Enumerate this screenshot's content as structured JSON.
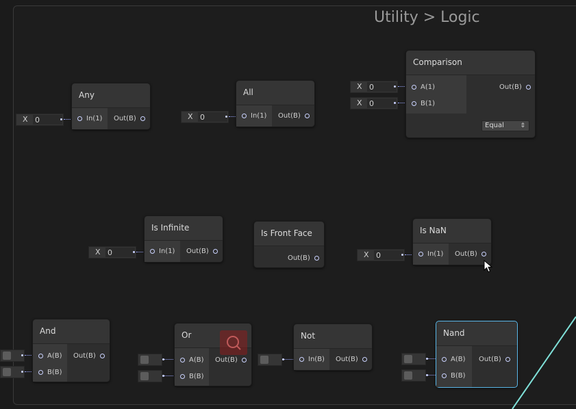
{
  "group_title": "Utility > Logic",
  "nodes": {
    "any": {
      "title": "Any",
      "in": "In(1)",
      "out": "Out(B)"
    },
    "all": {
      "title": "All",
      "in": "In(1)",
      "out": "Out(B)"
    },
    "comparison": {
      "title": "Comparison",
      "in_a": "A(1)",
      "in_b": "B(1)",
      "out": "Out(B)",
      "dropdown": "Equal"
    },
    "is_infinite": {
      "title": "Is Infinite",
      "in": "In(1)",
      "out": "Out(B)"
    },
    "is_front_face": {
      "title": "Is Front Face",
      "out": "Out(B)"
    },
    "is_nan": {
      "title": "Is NaN",
      "in": "In(1)",
      "out": "Out(B)"
    },
    "and": {
      "title": "And",
      "in_a": "A(B)",
      "in_b": "B(B)",
      "out": "Out(B)"
    },
    "or": {
      "title": "Or",
      "in_a": "A(B)",
      "in_b": "B(B)",
      "out": "Out(B)"
    },
    "not": {
      "title": "Not",
      "in": "In(B)",
      "out": "Out(B)"
    },
    "nand": {
      "title": "Nand",
      "in_a": "A(B)",
      "in_b": "B(B)",
      "out": "Out(B)"
    }
  },
  "field_x_label": "X",
  "field_value": "0",
  "dropdown_arrow": "⇕",
  "colors": {
    "port": "#cbd3ff",
    "selection": "#5ab7e8",
    "edge": "#7fe0d8"
  }
}
